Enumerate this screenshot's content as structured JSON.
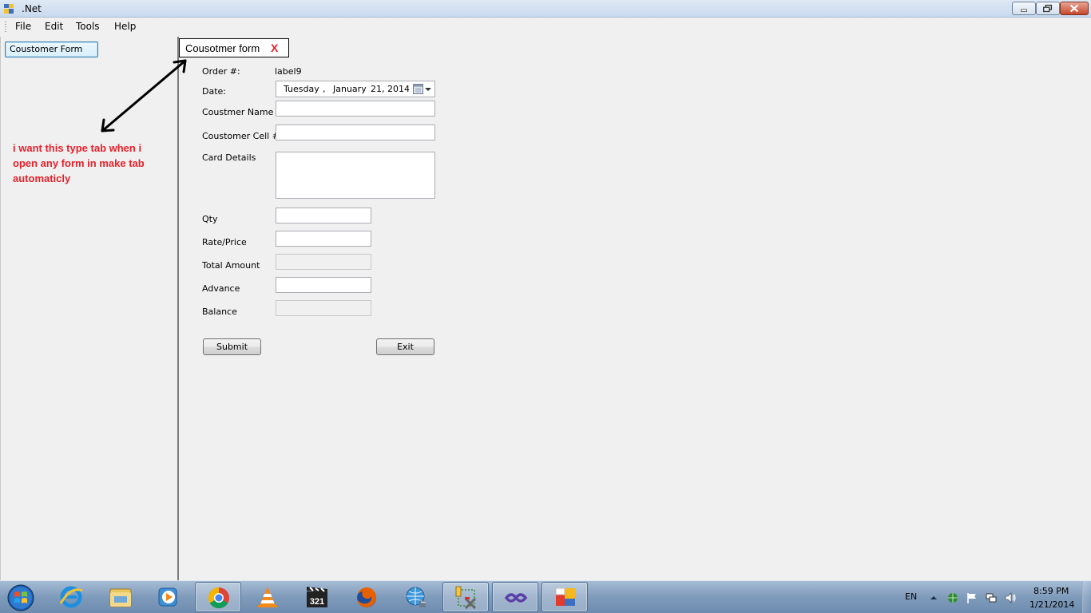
{
  "window": {
    "title": ".Net"
  },
  "menu": {
    "items": [
      "File",
      "Edit",
      "Tools",
      "Help"
    ]
  },
  "left_panel": {
    "customer_form_button": "Coustomer Form",
    "note": "i want this type tab when i open any form in make tab automaticly"
  },
  "tab": {
    "label": "Cousotmer form",
    "close": "X"
  },
  "form": {
    "order_label": "Order #:",
    "order_value": "label9",
    "date_label": "Date:",
    "date": {
      "day": "Tuesday",
      "sep": ",",
      "month": "January",
      "date": "21, 2014"
    },
    "customer_name_label": "Coustmer Name",
    "customer_cell_label": "Coustomer Cell #:",
    "card_details_label": "Card Details",
    "qty_label": "Qty",
    "rate_label": "Rate/Price",
    "total_label": "Total Amount",
    "advance_label": "Advance",
    "balance_label": "Balance",
    "submit": "Submit",
    "exit": "Exit"
  },
  "taskbar": {
    "language": "EN",
    "time": "8:59 PM",
    "date": "1/21/2014",
    "apps": [
      "internet-explorer-icon",
      "file-explorer-icon",
      "media-player-icon",
      "chrome-icon",
      "vlc-icon",
      "media-player-classic-icon",
      "firefox-icon",
      "network-globe-icon",
      "visual-studio-setup-icon",
      "visual-studio-icon",
      "windows-form-app-icon"
    ]
  },
  "colors": {
    "annotation": "#e8212b",
    "titlebar": "#c9d9ee",
    "taskbar": "#7f9bbb"
  }
}
